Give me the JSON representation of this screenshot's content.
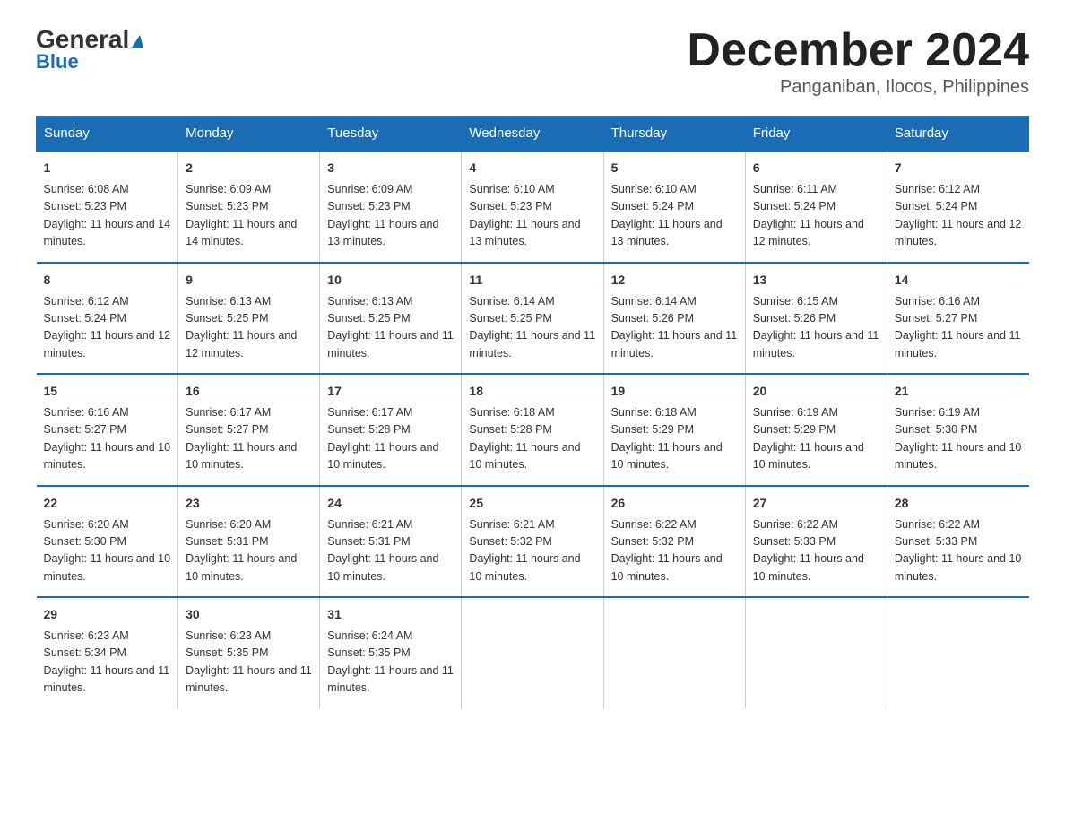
{
  "header": {
    "logo_general": "General",
    "logo_blue": "Blue",
    "month_title": "December 2024",
    "location": "Panganiban, Ilocos, Philippines"
  },
  "days_of_week": [
    "Sunday",
    "Monday",
    "Tuesday",
    "Wednesday",
    "Thursday",
    "Friday",
    "Saturday"
  ],
  "weeks": [
    [
      {
        "day": "1",
        "sunrise": "6:08 AM",
        "sunset": "5:23 PM",
        "daylight": "11 hours and 14 minutes."
      },
      {
        "day": "2",
        "sunrise": "6:09 AM",
        "sunset": "5:23 PM",
        "daylight": "11 hours and 14 minutes."
      },
      {
        "day": "3",
        "sunrise": "6:09 AM",
        "sunset": "5:23 PM",
        "daylight": "11 hours and 13 minutes."
      },
      {
        "day": "4",
        "sunrise": "6:10 AM",
        "sunset": "5:23 PM",
        "daylight": "11 hours and 13 minutes."
      },
      {
        "day": "5",
        "sunrise": "6:10 AM",
        "sunset": "5:24 PM",
        "daylight": "11 hours and 13 minutes."
      },
      {
        "day": "6",
        "sunrise": "6:11 AM",
        "sunset": "5:24 PM",
        "daylight": "11 hours and 12 minutes."
      },
      {
        "day": "7",
        "sunrise": "6:12 AM",
        "sunset": "5:24 PM",
        "daylight": "11 hours and 12 minutes."
      }
    ],
    [
      {
        "day": "8",
        "sunrise": "6:12 AM",
        "sunset": "5:24 PM",
        "daylight": "11 hours and 12 minutes."
      },
      {
        "day": "9",
        "sunrise": "6:13 AM",
        "sunset": "5:25 PM",
        "daylight": "11 hours and 12 minutes."
      },
      {
        "day": "10",
        "sunrise": "6:13 AM",
        "sunset": "5:25 PM",
        "daylight": "11 hours and 11 minutes."
      },
      {
        "day": "11",
        "sunrise": "6:14 AM",
        "sunset": "5:25 PM",
        "daylight": "11 hours and 11 minutes."
      },
      {
        "day": "12",
        "sunrise": "6:14 AM",
        "sunset": "5:26 PM",
        "daylight": "11 hours and 11 minutes."
      },
      {
        "day": "13",
        "sunrise": "6:15 AM",
        "sunset": "5:26 PM",
        "daylight": "11 hours and 11 minutes."
      },
      {
        "day": "14",
        "sunrise": "6:16 AM",
        "sunset": "5:27 PM",
        "daylight": "11 hours and 11 minutes."
      }
    ],
    [
      {
        "day": "15",
        "sunrise": "6:16 AM",
        "sunset": "5:27 PM",
        "daylight": "11 hours and 10 minutes."
      },
      {
        "day": "16",
        "sunrise": "6:17 AM",
        "sunset": "5:27 PM",
        "daylight": "11 hours and 10 minutes."
      },
      {
        "day": "17",
        "sunrise": "6:17 AM",
        "sunset": "5:28 PM",
        "daylight": "11 hours and 10 minutes."
      },
      {
        "day": "18",
        "sunrise": "6:18 AM",
        "sunset": "5:28 PM",
        "daylight": "11 hours and 10 minutes."
      },
      {
        "day": "19",
        "sunrise": "6:18 AM",
        "sunset": "5:29 PM",
        "daylight": "11 hours and 10 minutes."
      },
      {
        "day": "20",
        "sunrise": "6:19 AM",
        "sunset": "5:29 PM",
        "daylight": "11 hours and 10 minutes."
      },
      {
        "day": "21",
        "sunrise": "6:19 AM",
        "sunset": "5:30 PM",
        "daylight": "11 hours and 10 minutes."
      }
    ],
    [
      {
        "day": "22",
        "sunrise": "6:20 AM",
        "sunset": "5:30 PM",
        "daylight": "11 hours and 10 minutes."
      },
      {
        "day": "23",
        "sunrise": "6:20 AM",
        "sunset": "5:31 PM",
        "daylight": "11 hours and 10 minutes."
      },
      {
        "day": "24",
        "sunrise": "6:21 AM",
        "sunset": "5:31 PM",
        "daylight": "11 hours and 10 minutes."
      },
      {
        "day": "25",
        "sunrise": "6:21 AM",
        "sunset": "5:32 PM",
        "daylight": "11 hours and 10 minutes."
      },
      {
        "day": "26",
        "sunrise": "6:22 AM",
        "sunset": "5:32 PM",
        "daylight": "11 hours and 10 minutes."
      },
      {
        "day": "27",
        "sunrise": "6:22 AM",
        "sunset": "5:33 PM",
        "daylight": "11 hours and 10 minutes."
      },
      {
        "day": "28",
        "sunrise": "6:22 AM",
        "sunset": "5:33 PM",
        "daylight": "11 hours and 10 minutes."
      }
    ],
    [
      {
        "day": "29",
        "sunrise": "6:23 AM",
        "sunset": "5:34 PM",
        "daylight": "11 hours and 11 minutes."
      },
      {
        "day": "30",
        "sunrise": "6:23 AM",
        "sunset": "5:35 PM",
        "daylight": "11 hours and 11 minutes."
      },
      {
        "day": "31",
        "sunrise": "6:24 AM",
        "sunset": "5:35 PM",
        "daylight": "11 hours and 11 minutes."
      },
      {
        "day": "",
        "sunrise": "",
        "sunset": "",
        "daylight": ""
      },
      {
        "day": "",
        "sunrise": "",
        "sunset": "",
        "daylight": ""
      },
      {
        "day": "",
        "sunrise": "",
        "sunset": "",
        "daylight": ""
      },
      {
        "day": "",
        "sunrise": "",
        "sunset": "",
        "daylight": ""
      }
    ]
  ]
}
